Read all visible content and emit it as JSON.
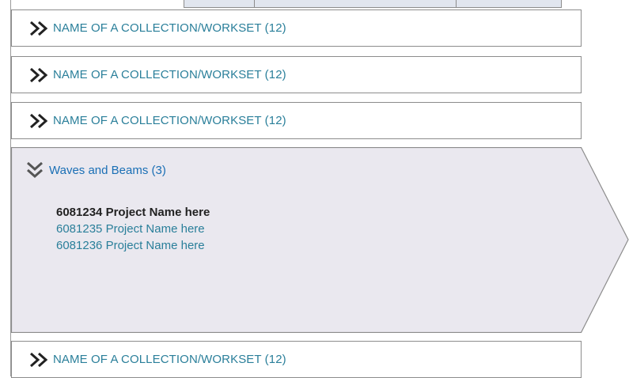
{
  "collections": {
    "row_1": {
      "label": "NAME OF A COLLECTION/WORKSET (12)"
    },
    "row_2": {
      "label": "NAME OF A COLLECTION/WORKSET (12)"
    },
    "row_3": {
      "label": "NAME OF A COLLECTION/WORKSET (12)"
    },
    "row_5": {
      "label": "NAME OF A COLLECTION/WORKSET (12)"
    }
  },
  "expanded": {
    "title": "Waves and Beams (3)",
    "projects": [
      {
        "label": "6081234 Project Name here",
        "selected": true
      },
      {
        "label": "6081235 Project Name here",
        "selected": false
      },
      {
        "label": "6081236 Project Name here",
        "selected": false
      }
    ]
  },
  "colors": {
    "link": "#2a7f9a",
    "title_link": "#1a6fb5",
    "expanded_bg": "#eae8ef",
    "border": "#8c8c8c",
    "tab_fill": "#e1e6ef"
  },
  "icons": {
    "collapsed": "chevron-double-right-icon",
    "expanded": "chevron-double-down-icon"
  }
}
